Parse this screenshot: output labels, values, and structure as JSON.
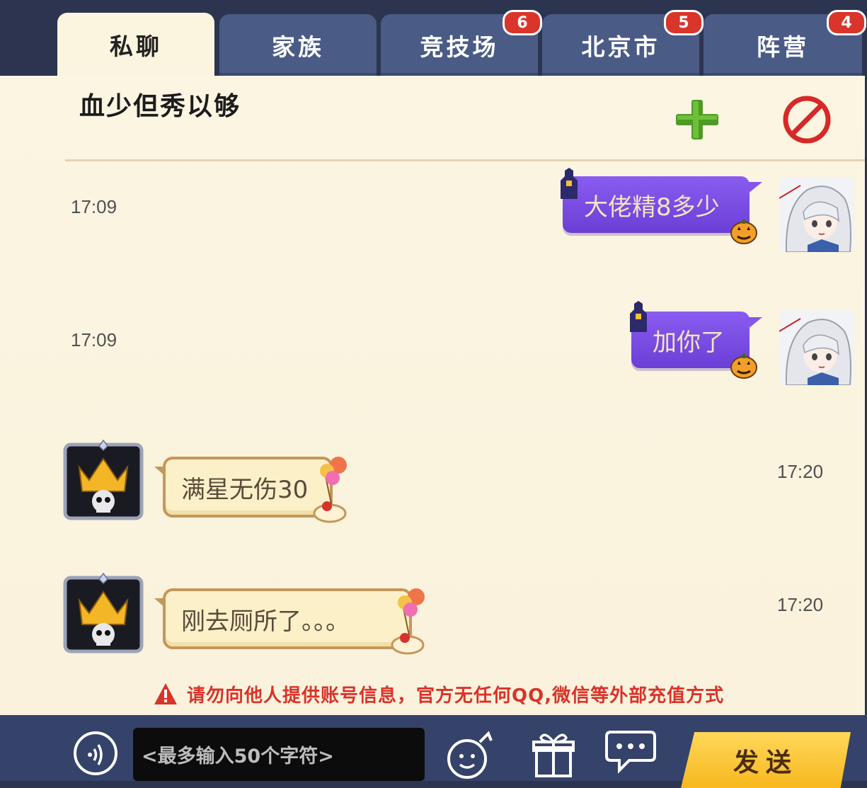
{
  "tabs": [
    {
      "label": "私聊",
      "active": true
    },
    {
      "label": "家族"
    },
    {
      "label": "竞技场",
      "badge": "6"
    },
    {
      "label": "北京市",
      "badge": "5"
    },
    {
      "label": "阵营",
      "badge": "4"
    }
  ],
  "chat": {
    "title": "血少但秀以够",
    "icons": {
      "add": "plus-icon",
      "block": "block-icon"
    }
  },
  "messages": [
    {
      "time": "17:09",
      "text": "大佬精8多少",
      "direction": "outgoing"
    },
    {
      "time": "17:09",
      "text": "加你了",
      "direction": "outgoing"
    },
    {
      "time": "17:20",
      "text": "满星无伤30",
      "direction": "incoming"
    },
    {
      "time": "17:20",
      "text": "刚去厕所了。。。",
      "direction": "incoming"
    }
  ],
  "warning": "请勿向他人提供账号信息，官方无任何QQ,微信等外部充值方式",
  "bottom": {
    "input_placeholder": "<最多输入50个字符>",
    "send_label": "发送",
    "icons": [
      "voice-icon",
      "emoji-icon",
      "gift-icon",
      "quick-chat-icon"
    ]
  },
  "colors": {
    "accent": "#7a4ce6",
    "warning": "#d9332a",
    "send": "#f7b81f"
  }
}
